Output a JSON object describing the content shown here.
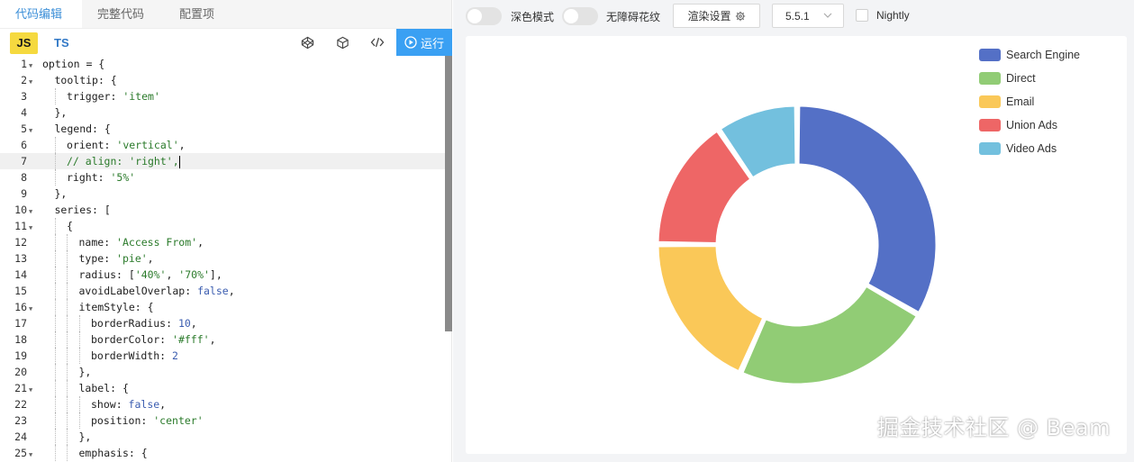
{
  "tabs": [
    {
      "label": "代码编辑",
      "active": true
    },
    {
      "label": "完整代码",
      "active": false
    },
    {
      "label": "配置项",
      "active": false
    }
  ],
  "toolbar": {
    "js_label": "JS",
    "ts_label": "TS",
    "run_label": "运行",
    "icons": [
      "codepen-icon",
      "codesandbox-icon",
      "code-tag-icon",
      "play-circle-icon"
    ]
  },
  "editor": {
    "current_line": 7,
    "lines": [
      {
        "n": "1",
        "fold": true,
        "indent": 0,
        "html": "option = {"
      },
      {
        "n": "2",
        "fold": true,
        "indent": 1,
        "html": "tooltip: {"
      },
      {
        "n": "3",
        "fold": false,
        "indent": 2,
        "html": "trigger: <span class=\"str\">'item'</span>"
      },
      {
        "n": "4",
        "fold": false,
        "indent": 1,
        "html": "},"
      },
      {
        "n": "5",
        "fold": true,
        "indent": 1,
        "html": "legend: {"
      },
      {
        "n": "6",
        "fold": false,
        "indent": 2,
        "html": "orient: <span class=\"str\">'vertical'</span>,"
      },
      {
        "n": "7",
        "fold": false,
        "indent": 2,
        "html": "<span class=\"str\">// align: 'right',</span><span class=\"caret\"></span>"
      },
      {
        "n": "8",
        "fold": false,
        "indent": 2,
        "html": "right: <span class=\"str\">'5%'</span>"
      },
      {
        "n": "9",
        "fold": false,
        "indent": 1,
        "html": "},"
      },
      {
        "n": "10",
        "fold": true,
        "indent": 1,
        "html": "series: ["
      },
      {
        "n": "11",
        "fold": true,
        "indent": 2,
        "html": "{"
      },
      {
        "n": "12",
        "fold": false,
        "indent": 3,
        "html": "name: <span class=\"str\">'Access From'</span>,"
      },
      {
        "n": "13",
        "fold": false,
        "indent": 3,
        "html": "type: <span class=\"str\">'pie'</span>,"
      },
      {
        "n": "14",
        "fold": false,
        "indent": 3,
        "html": "radius: [<span class=\"str\">'40%'</span>, <span class=\"str\">'70%'</span>],"
      },
      {
        "n": "15",
        "fold": false,
        "indent": 3,
        "html": "avoidLabelOverlap: <span class=\"kw\">false</span>,"
      },
      {
        "n": "16",
        "fold": true,
        "indent": 3,
        "html": "itemStyle: {"
      },
      {
        "n": "17",
        "fold": false,
        "indent": 4,
        "html": "borderRadius: <span class=\"kw\">10</span>,"
      },
      {
        "n": "18",
        "fold": false,
        "indent": 4,
        "html": "borderColor: <span class=\"str\">'#fff'</span>,"
      },
      {
        "n": "19",
        "fold": false,
        "indent": 4,
        "html": "borderWidth: <span class=\"kw\">2</span>"
      },
      {
        "n": "20",
        "fold": false,
        "indent": 3,
        "html": "},"
      },
      {
        "n": "21",
        "fold": true,
        "indent": 3,
        "html": "label: {"
      },
      {
        "n": "22",
        "fold": false,
        "indent": 4,
        "html": "show: <span class=\"kw\">false</span>,"
      },
      {
        "n": "23",
        "fold": false,
        "indent": 4,
        "html": "position: <span class=\"str\">'center'</span>"
      },
      {
        "n": "24",
        "fold": false,
        "indent": 3,
        "html": "},"
      },
      {
        "n": "25",
        "fold": true,
        "indent": 3,
        "html": "emphasis: {"
      }
    ]
  },
  "topbar": {
    "dark_mode_label": "深色模式",
    "accessibility_label": "无障碍花纹",
    "render_settings_label": "渲染设置",
    "version": "5.5.1",
    "nightly_label": "Nightly"
  },
  "colors": {
    "accent": "#3aa0f3",
    "tab_active": "#3c8fd8"
  },
  "chart_data": {
    "type": "pie",
    "variant": "donut",
    "radius": [
      "40%",
      "70%"
    ],
    "legend_placement": "top-right",
    "legend_orient": "vertical",
    "slices": [
      {
        "name": "Search Engine",
        "value": 1048,
        "color": "#5470c6"
      },
      {
        "name": "Direct",
        "value": 735,
        "color": "#91cc75"
      },
      {
        "name": "Email",
        "value": 580,
        "color": "#fac858"
      },
      {
        "name": "Union Ads",
        "value": 484,
        "color": "#ee6666"
      },
      {
        "name": "Video Ads",
        "value": 300,
        "color": "#73c0de"
      }
    ]
  },
  "watermark": "掘金技术社区 @ Beam"
}
